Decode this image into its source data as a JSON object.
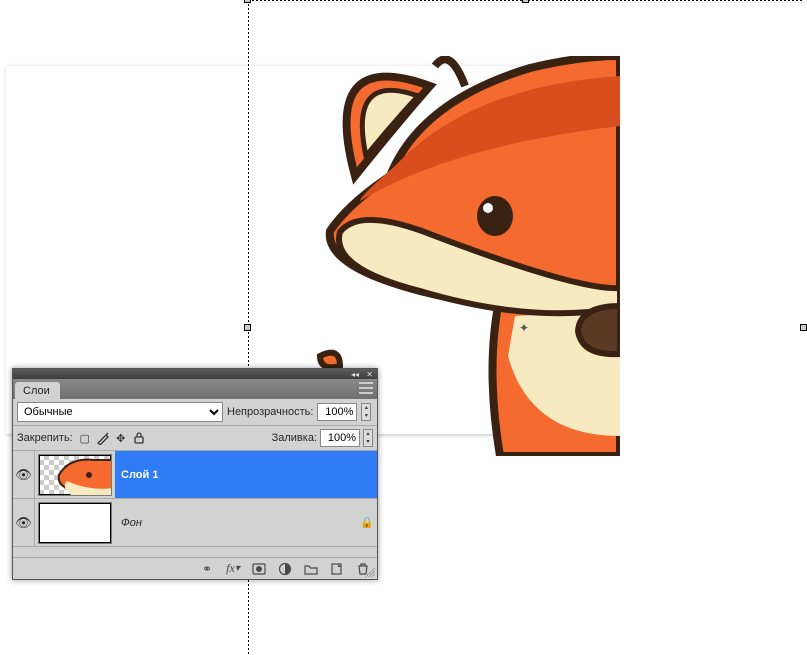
{
  "panel": {
    "title": "Слои",
    "blend_mode_selected": "Обычные",
    "opacity_label": "Непрозрачность:",
    "opacity_value": "100%",
    "lock_label": "Закрепить:",
    "fill_label": "Заливка:",
    "fill_value": "100%",
    "layers": [
      {
        "name": "Слой 1",
        "visible": true,
        "locked": false,
        "selected": true
      },
      {
        "name": "Фон",
        "visible": true,
        "locked": true,
        "selected": false
      }
    ],
    "footer_icons": [
      "link-icon",
      "fx-icon",
      "mask-icon",
      "adjustment-icon",
      "group-icon",
      "new-layer-icon",
      "delete-icon"
    ]
  },
  "transform": {
    "center_glyph": "✦"
  },
  "colors": {
    "selection": "#2f7cf6",
    "fox_body": "#f46a2f",
    "fox_dark": "#d84f1d",
    "fox_cream": "#f8eac0",
    "fox_outline": "#3a2213"
  }
}
